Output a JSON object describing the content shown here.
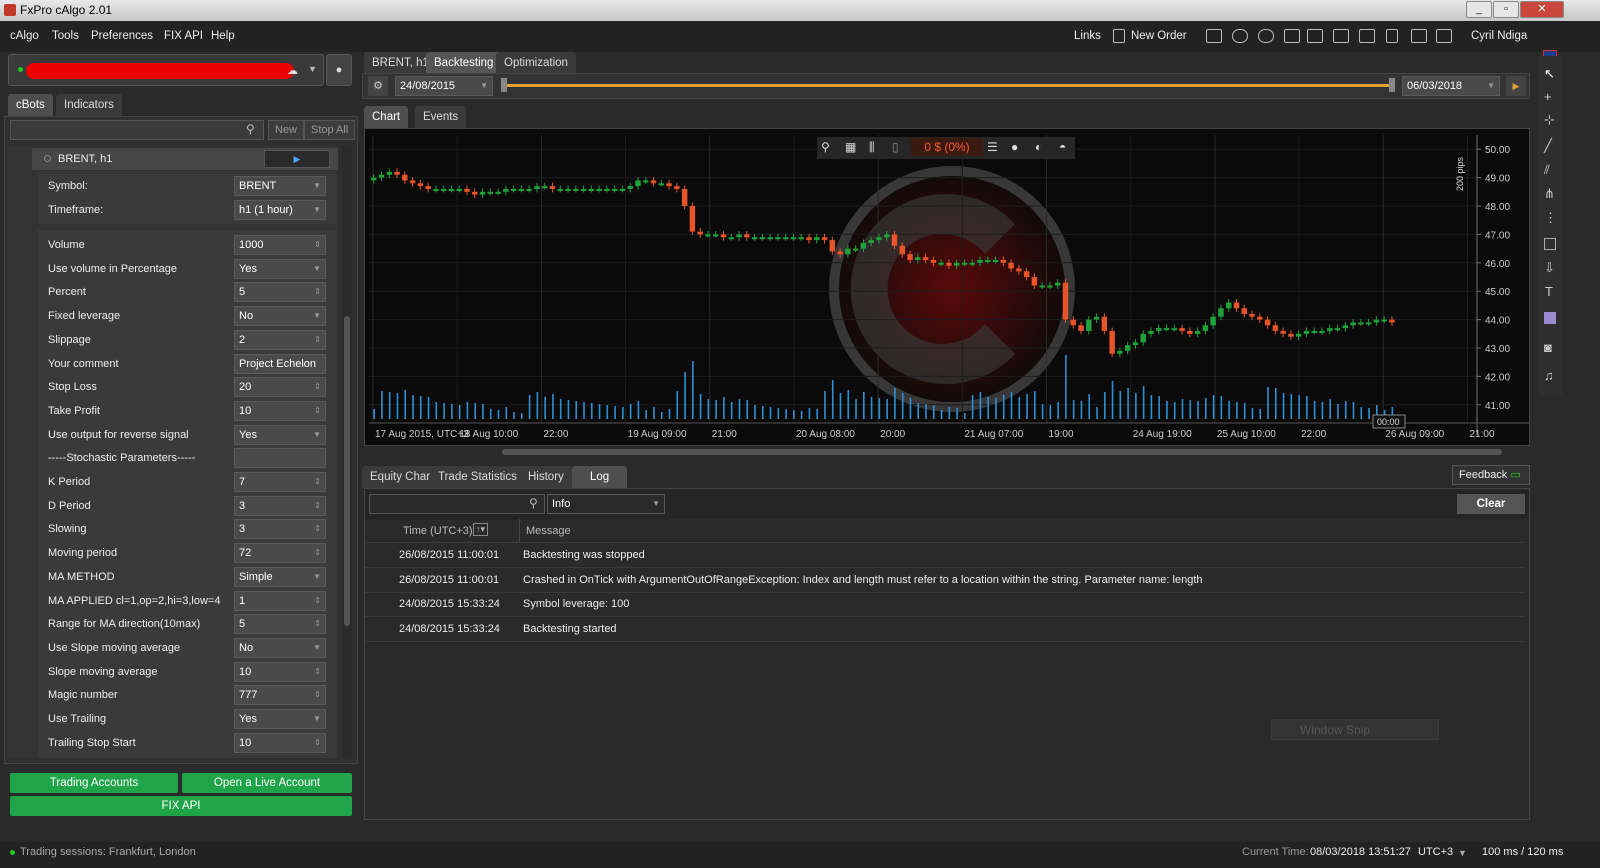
{
  "window": {
    "title": "FxPro cAlgo 2.01"
  },
  "menu": {
    "items": [
      "cAlgo",
      "Tools",
      "Preferences",
      "FIX API",
      "Help"
    ]
  },
  "toolbar": {
    "links": "Links",
    "new_order": "New Order",
    "user": "Cyril Ndiga"
  },
  "left": {
    "tabs": [
      "cBots",
      "Indicators"
    ],
    "new_label": "New",
    "stop_all_label": "Stop All",
    "instance": "BRENT, h1",
    "symbol_label": "Symbol:",
    "symbol": "BRENT",
    "timeframe_label": "Timeframe:",
    "timeframe": "h1 (1 hour)",
    "params": [
      {
        "label": "Volume",
        "value": "1000",
        "kind": "num"
      },
      {
        "label": "Use volume in Percentage",
        "value": "Yes",
        "kind": "sel"
      },
      {
        "label": "Percent",
        "value": "5",
        "kind": "num"
      },
      {
        "label": "Fixed leverage",
        "value": "No",
        "kind": "sel"
      },
      {
        "label": "Slippage",
        "value": "2",
        "kind": "num"
      },
      {
        "label": "Your comment",
        "value": "Project Echelon",
        "kind": "txt"
      },
      {
        "label": "Stop Loss",
        "value": "20",
        "kind": "num"
      },
      {
        "label": "Take Profit",
        "value": "10",
        "kind": "num"
      },
      {
        "label": "Use output for reverse signal",
        "value": "Yes",
        "kind": "sel"
      },
      {
        "label": "-----Stochastic Parameters-----",
        "value": "",
        "kind": "txt"
      },
      {
        "label": "K Period",
        "value": "7",
        "kind": "num"
      },
      {
        "label": "D Period",
        "value": "3",
        "kind": "num"
      },
      {
        "label": "Slowing",
        "value": "3",
        "kind": "num"
      },
      {
        "label": "Moving period",
        "value": "72",
        "kind": "num"
      },
      {
        "label": "MA METHOD",
        "value": "Simple",
        "kind": "sel"
      },
      {
        "label": "MA APPLIED cl=1,op=2,hi=3,low=4",
        "value": "1",
        "kind": "num"
      },
      {
        "label": "Range for MA direction(10max)",
        "value": "5",
        "kind": "num"
      },
      {
        "label": "Use Slope moving average",
        "value": "No",
        "kind": "sel"
      },
      {
        "label": "Slope moving average",
        "value": "10",
        "kind": "num"
      },
      {
        "label": "Magic number",
        "value": "777",
        "kind": "num"
      },
      {
        "label": "Use Trailing",
        "value": "Yes",
        "kind": "sel"
      },
      {
        "label": "Trailing Stop Start",
        "value": "10",
        "kind": "num"
      }
    ],
    "trading_accounts": "Trading Accounts",
    "open_live": "Open a Live Account",
    "fix_api": "FIX API"
  },
  "center": {
    "tabs": [
      "BRENT, h1",
      "Backtesting",
      "Optimization"
    ],
    "start_date": "24/08/2015",
    "end_date": "06/03/2018",
    "chart_tabs": [
      "Chart",
      "Events"
    ],
    "pnl": "0 $ (0%)",
    "pips_label": "200 pips",
    "bottom_tabs": [
      "Equity Chart",
      "Trade Statistics",
      "History",
      "Log"
    ],
    "feedback": "Feedback",
    "log_level": "Info",
    "clear": "Clear",
    "col_time": "Time (UTC+3)",
    "col_msg": "Message",
    "log": [
      {
        "time": "26/08/2015 11:00:01",
        "msg": "Backtesting was stopped"
      },
      {
        "time": "26/08/2015 11:00:01",
        "msg": "Crashed in OnTick with ArgumentOutOfRangeException: Index and length must refer to a location within the string. Parameter name: length"
      },
      {
        "time": "24/08/2015 15:33:24",
        "msg": "Symbol leverage:  100"
      },
      {
        "time": "24/08/2015 15:33:24",
        "msg": "Backtesting started"
      }
    ],
    "snip": "Window Snip"
  },
  "status": {
    "sessions": "Trading sessions:  Frankfurt, London",
    "current_label": "Current Time:",
    "current_time": "08/03/2018 13:51:27",
    "tz": "UTC+3",
    "latency": "100 ms / 120 ms"
  },
  "chart_data": {
    "type": "candlestick",
    "yticks": [
      "50.00",
      "49.00",
      "48.00",
      "47.00",
      "46.00",
      "45.00",
      "44.00",
      "43.00",
      "42.00",
      "41.00"
    ],
    "xticks": [
      "17 Aug 2015, UTC+3",
      "18 Aug 10:00",
      "22:00",
      "19 Aug 09:00",
      "21:00",
      "20 Aug 08:00",
      "20:00",
      "21 Aug 07:00",
      "19:00",
      "24 Aug 19:00",
      "25 Aug 10:00",
      "22:00",
      "26 Aug 09:00",
      "21:00"
    ],
    "cursor_label": "00:00",
    "ylim": [
      40.5,
      50.5
    ],
    "close": [
      49.0,
      49.1,
      49.2,
      49.1,
      48.9,
      48.8,
      48.7,
      48.6,
      48.6,
      48.6,
      48.6,
      48.6,
      48.5,
      48.4,
      48.5,
      48.5,
      48.5,
      48.6,
      48.6,
      48.6,
      48.6,
      48.7,
      48.7,
      48.6,
      48.6,
      48.6,
      48.6,
      48.6,
      48.6,
      48.6,
      48.6,
      48.6,
      48.6,
      48.7,
      48.9,
      48.9,
      48.8,
      48.8,
      48.7,
      48.6,
      48.0,
      47.1,
      47.0,
      47.0,
      47.0,
      46.9,
      46.9,
      47.0,
      46.9,
      46.9,
      46.9,
      46.9,
      46.9,
      46.9,
      46.9,
      46.9,
      46.8,
      46.9,
      46.8,
      46.4,
      46.3,
      46.5,
      46.5,
      46.7,
      46.8,
      46.9,
      47.0,
      46.6,
      46.3,
      46.1,
      46.2,
      46.1,
      46.0,
      46.0,
      45.9,
      46.0,
      46.0,
      46.0,
      46.1,
      46.1,
      46.1,
      46.0,
      45.8,
      45.7,
      45.5,
      45.2,
      45.2,
      45.2,
      45.3,
      44.0,
      43.8,
      43.6,
      44.0,
      44.1,
      43.6,
      42.8,
      42.9,
      43.1,
      43.2,
      43.5,
      43.6,
      43.7,
      43.7,
      43.7,
      43.6,
      43.5,
      43.6,
      43.8,
      44.1,
      44.4,
      44.6,
      44.4,
      44.2,
      44.1,
      44.0,
      43.8,
      43.6,
      43.5,
      43.4,
      43.5,
      43.6,
      43.6,
      43.6,
      43.7,
      43.7,
      43.8,
      43.9,
      43.9,
      43.9,
      44.0,
      44.0,
      43.9
    ]
  }
}
